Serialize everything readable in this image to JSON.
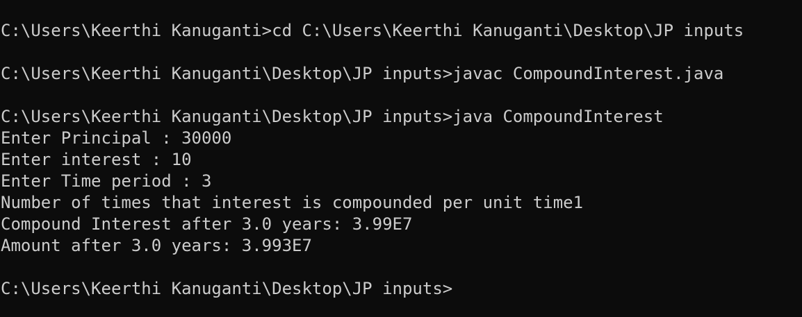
{
  "terminal": {
    "lines": [
      "C:\\Users\\Keerthi Kanuganti>cd C:\\Users\\Keerthi Kanuganti\\Desktop\\JP inputs",
      "",
      "C:\\Users\\Keerthi Kanuganti\\Desktop\\JP inputs>javac CompoundInterest.java",
      "",
      "C:\\Users\\Keerthi Kanuganti\\Desktop\\JP inputs>java CompoundInterest",
      "Enter Principal : 30000",
      "Enter interest : 10",
      "Enter Time period : 3",
      "Number of times that interest is compounded per unit time1",
      "Compound Interest after 3.0 years: 3.99E7",
      "Amount after 3.0 years: 3.993E7",
      "",
      "C:\\Users\\Keerthi Kanuganti\\Desktop\\JP inputs>"
    ]
  },
  "colors": {
    "background": "#0c0c0c",
    "foreground": "#cccccc"
  }
}
